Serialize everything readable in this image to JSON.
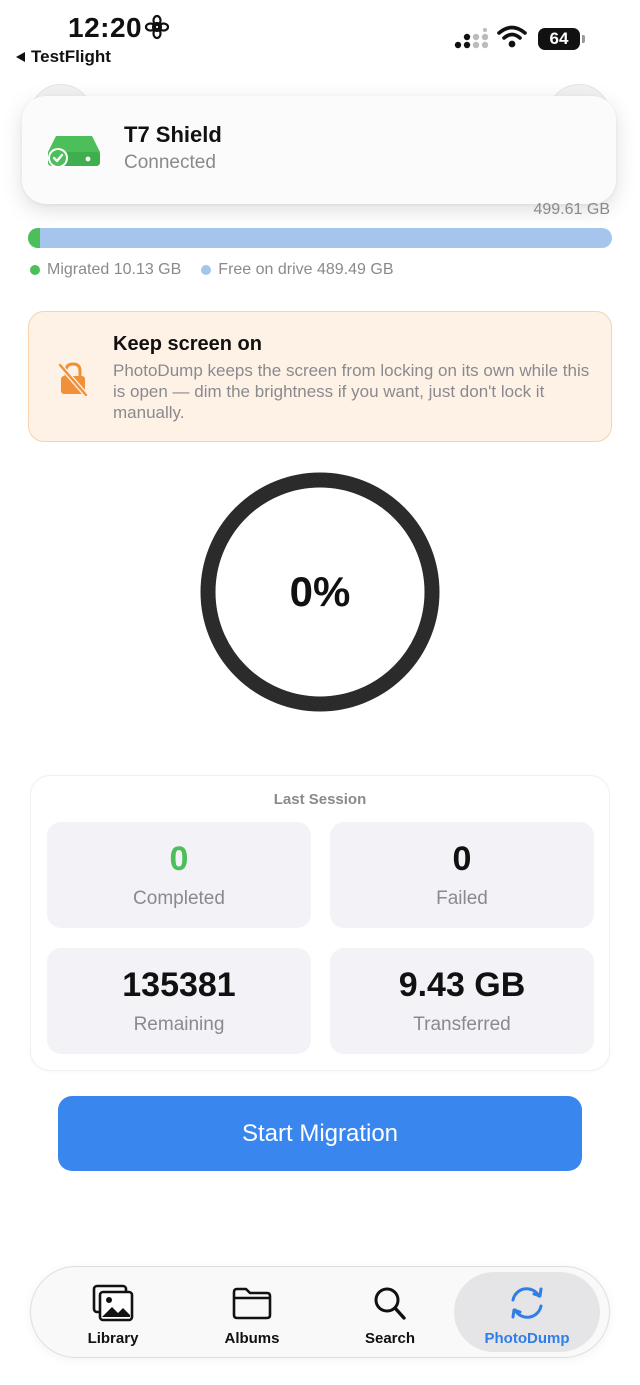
{
  "status_bar": {
    "time": "12:20",
    "back_app": "TestFlight",
    "battery": "64"
  },
  "drive": {
    "name": "T7 Shield",
    "status": "Connected",
    "capacity": "499.61 GB",
    "used_fraction": 0.02,
    "legend_used": "Migrated 10.13 GB",
    "legend_free": "Free on drive 489.49 GB"
  },
  "notice": {
    "title": "Keep screen on",
    "body": "PhotoDump keeps the screen from locking on its own while this is open — dim the brightness if you want, just don't lock it manually."
  },
  "progress": {
    "label": "0%",
    "value": 0
  },
  "session": {
    "title": "Last Session",
    "stats": [
      {
        "value": "0",
        "label": "Completed"
      },
      {
        "value": "0",
        "label": "Failed"
      },
      {
        "value": "135381",
        "label": "Remaining"
      },
      {
        "value": "9.43 GB",
        "label": "Transferred"
      }
    ]
  },
  "start_button": "Start Migration",
  "tabs": [
    {
      "label": "Library",
      "icon": "photo-library-icon"
    },
    {
      "label": "Albums",
      "icon": "folder-icon"
    },
    {
      "label": "Search",
      "icon": "search-icon"
    },
    {
      "label": "PhotoDump",
      "icon": "sync-icon",
      "active": true
    }
  ],
  "colors": {
    "accent": "#3a86ef",
    "success": "#4cbe5a",
    "free": "#a6c5ec",
    "warning": "#f0913a"
  }
}
